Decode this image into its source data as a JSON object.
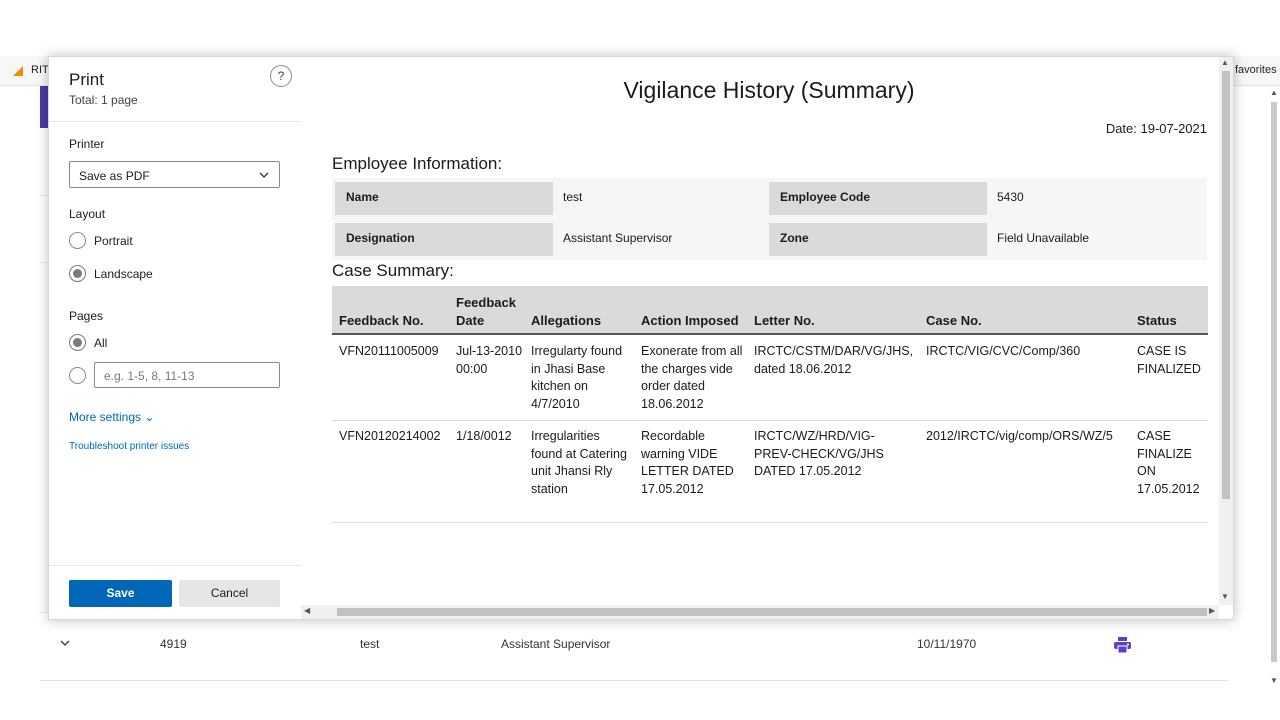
{
  "bookmarks": {
    "left": "RIT",
    "right": "favorites"
  },
  "background_row": {
    "employee_code": "4919",
    "name": "test",
    "designation": "Assistant Supervisor",
    "date": "10/11/1970"
  },
  "print_panel": {
    "title": "Print",
    "total": "Total: 1 page",
    "help": "?",
    "printer_label": "Printer",
    "printer_value": "Save as PDF",
    "layout_label": "Layout",
    "layout_options": [
      "Portrait",
      "Landscape"
    ],
    "layout_selected": "Landscape",
    "pages_label": "Pages",
    "pages_all": "All",
    "pages_range_placeholder": "e.g. 1-5, 8, 11-13",
    "more_settings": "More settings",
    "troubleshoot": "Troubleshoot printer issues",
    "save": "Save",
    "cancel": "Cancel"
  },
  "report": {
    "title": "Vigilance History (Summary)",
    "date": "Date: 19-07-2021",
    "employee_heading": "Employee Information:",
    "employee": {
      "name_label": "Name",
      "name_value": "test",
      "code_label": "Employee Code",
      "code_value": "5430",
      "designation_label": "Designation",
      "designation_value": "Assistant Supervisor",
      "zone_label": "Zone",
      "zone_value": "Field Unavailable"
    },
    "case_heading": "Case Summary:",
    "columns": [
      "Feedback No.",
      "Feedback Date",
      "Allegations",
      "Action Imposed",
      "Letter No.",
      "Case No.",
      "Status"
    ],
    "rows": [
      {
        "feedback_no": "VFN20111005009",
        "feedback_date": "Jul-13-2010 00:00",
        "allegations": "Irregularty found in Jhasi Base kitchen on 4/7/2010",
        "action": "Exonerate from all the charges vide order dated 18.06.2012",
        "letter_no": "IRCTC/CSTM/DAR/VG/JHS, dated 18.06.2012",
        "case_no": "IRCTC/VIG/CVC/Comp/360",
        "status": "CASE IS FINALIZED"
      },
      {
        "feedback_no": "VFN20120214002",
        "feedback_date": "1/18/0012",
        "allegations": "Irregularities found at Catering unit Jhansi Rly station",
        "action": "Recordable warning VIDE LETTER DATED 17.05.2012",
        "letter_no": "IRCTC/WZ/HRD/VIG-PREV-CHECK/VG/JHS DATED 17.05.2012",
        "case_no": "2012/IRCTC/vig/comp/ORS/WZ/5",
        "status": "CASE FINALIZE ON 17.05.2012"
      }
    ]
  },
  "colors": {
    "accent": "#0067b8",
    "brand_purple": "#4b3aa6",
    "print_icon": "#5b3fc4"
  }
}
